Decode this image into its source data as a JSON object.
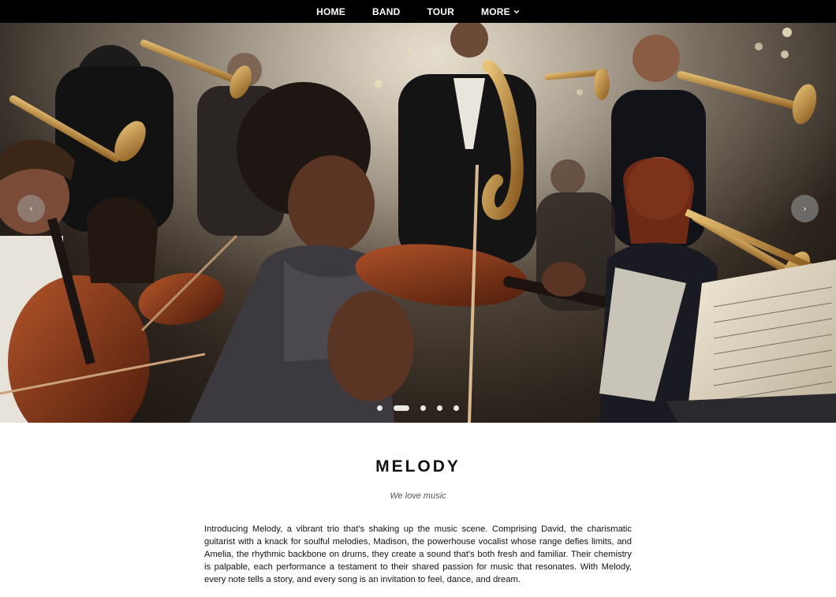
{
  "nav": {
    "items": [
      {
        "label": "HOME"
      },
      {
        "label": "BAND"
      },
      {
        "label": "TOUR"
      },
      {
        "label": "MORE"
      }
    ]
  },
  "carousel": {
    "prev_label": "‹",
    "next_label": "›",
    "slide_count": 5,
    "active_index": 1
  },
  "main": {
    "title": "MELODY",
    "subtitle": "We love music",
    "description": "Introducing Melody, a vibrant trio that's shaking up the music scene. Comprising David, the charismatic guitarist with a knack for soulful melodies, Madison, the powerhouse vocalist whose range defies limits, and Amelia, the rhythmic backbone on drums, they create a sound that's both fresh and familiar. Their chemistry is palpable, each performance a testament to their shared passion for music that resonates. With Melody, every note tells a story, and every song is an invitation to feel, dance, and dream."
  },
  "colors": {
    "navbar_bg": "#000000",
    "nav_text": "#ffffff",
    "title_text": "#111111"
  }
}
